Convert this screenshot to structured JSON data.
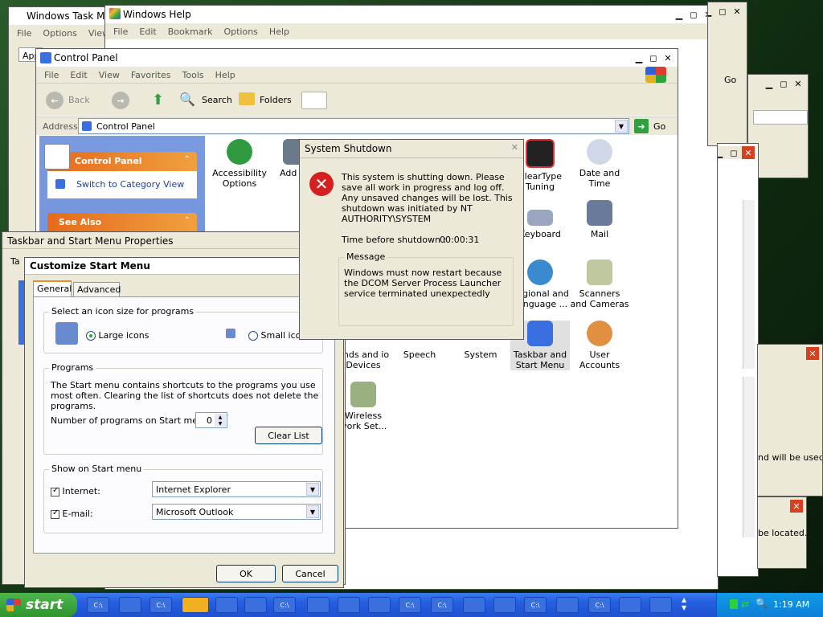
{
  "task_manager": {
    "title": "Windows Task M",
    "menu": [
      "File",
      "Options",
      "View"
    ],
    "tab": "App"
  },
  "windows_help": {
    "title": "Windows Help",
    "menu": [
      "File",
      "Edit",
      "Bookmark",
      "Options",
      "Help"
    ]
  },
  "right_window": {
    "go_label": "Go"
  },
  "right_window_2": {
    "text": "nd will be used"
  },
  "right_window_3": {
    "text": "be located."
  },
  "control_panel": {
    "title": "Control Panel",
    "menu": [
      "File",
      "Edit",
      "View",
      "Favorites",
      "Tools",
      "Help"
    ],
    "toolbar": {
      "back": "Back",
      "search": "Search",
      "folders": "Folders"
    },
    "address_label": "Address",
    "address_value": "Control Panel",
    "go_label": "Go",
    "side_panel": {
      "title": "Control Panel",
      "switch_link": "Switch to Category View",
      "see_also": "See Also"
    },
    "icons": [
      {
        "label": "Accessibility Options"
      },
      {
        "label": "Add Ha"
      },
      {
        "label": "ClearType Tuning"
      },
      {
        "label": "Date and Time"
      },
      {
        "label": "Keyboard"
      },
      {
        "label": "Mail"
      },
      {
        "label": "Regional and Language ..."
      },
      {
        "label": "Scanners and Cameras"
      },
      {
        "label": "unds and io Devices"
      },
      {
        "label": "Speech"
      },
      {
        "label": "System"
      },
      {
        "label": "Taskbar and Start Menu"
      },
      {
        "label": "User Accounts"
      },
      {
        "label": "Wireless work Set..."
      }
    ]
  },
  "taskbar_props": {
    "title": "Taskbar and Start Menu Properties",
    "tab": "Ta"
  },
  "customize": {
    "title": "Customize Start Menu",
    "tabs": [
      "General",
      "Advanced"
    ],
    "icon_size_group": "Select an icon size for programs",
    "large_icons": "Large icons",
    "small_icons": "Small icon",
    "programs_group": "Programs",
    "programs_text": "The Start menu contains shortcuts to the programs you use most often. Clearing the list of shortcuts does not delete the programs.",
    "number_label": "Number of programs on Start menu:",
    "number_value": "0",
    "clear_list": "Clear List",
    "show_group": "Show on Start menu",
    "internet_label": "Internet:",
    "internet_value": "Internet Explorer",
    "email_label": "E-mail:",
    "email_value": "Microsoft Outlook",
    "ok": "OK",
    "cancel": "Cancel"
  },
  "shutdown": {
    "title": "System Shutdown",
    "message": "This system is shutting down. Please save all work in progress and log off. Any unsaved changes will be lost. This shutdown was initiated by NT AUTHORITY\\SYSTEM",
    "time_label": "Time before shutdown :",
    "time_value": "00:00:31",
    "message_group": "Message",
    "message_detail": "Windows must now restart because the DCOM Server Process Launcher service terminated unexpectedly"
  },
  "taskbar": {
    "start": "start",
    "clock": "1:19 AM",
    "items": [
      "C:\\",
      "",
      "C:\\",
      "",
      "",
      "",
      "C:\\",
      "",
      "",
      "",
      "C:\\",
      "C:\\",
      "",
      "",
      "C:\\",
      "",
      "C:\\",
      "",
      ""
    ]
  },
  "colors": {
    "xp_blue": "#245ee0",
    "start_green": "#2f942f",
    "error_red": "#d42020",
    "side_orange": "#e66a1a"
  }
}
